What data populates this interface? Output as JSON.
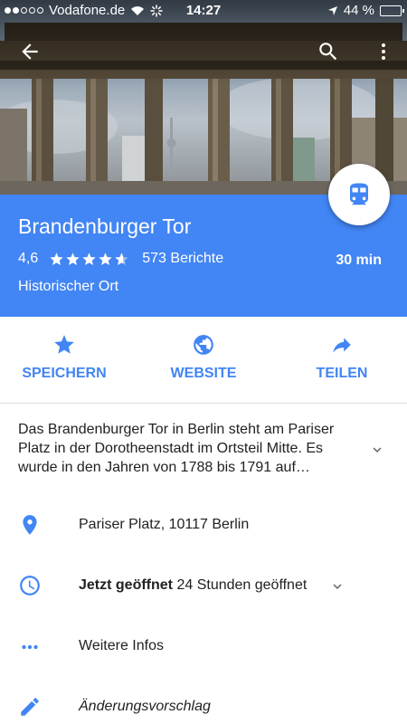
{
  "status_bar": {
    "carrier": "Vodafone.de",
    "time": "14:27",
    "battery": "44 %",
    "battery_level": 0.44
  },
  "nav": {
    "back_icon": "arrow-back-icon",
    "search_icon": "search-icon",
    "more_icon": "more-vert-icon"
  },
  "place": {
    "name": "Brandenburger Tor",
    "rating": "4,6",
    "rating_value": 4.6,
    "reviews": "573 Berichte",
    "category": "Historischer Ort",
    "travel_time": "30 min",
    "transit_icon": "train-icon"
  },
  "actions": [
    {
      "label": "SPEICHERN",
      "icon": "star-icon"
    },
    {
      "label": "WEBSITE",
      "icon": "globe-icon"
    },
    {
      "label": "TEILEN",
      "icon": "share-icon"
    }
  ],
  "description": "Das Brandenburger Tor in Berlin steht am Pariser Platz in der Dorotheenstadt im Ortsteil Mitte. Es wurde in den Jahren von 1788 bis 1791 auf…",
  "info": {
    "address": "Pariser Platz, 10117 Berlin",
    "hours_status": "Jetzt geöffnet",
    "hours_detail": "24 Stunden geöffnet",
    "more_info": "Weitere Infos",
    "suggest_edit": "Änderungsvorschlag"
  },
  "colors": {
    "accent": "#4285f4",
    "text": "#212121"
  }
}
